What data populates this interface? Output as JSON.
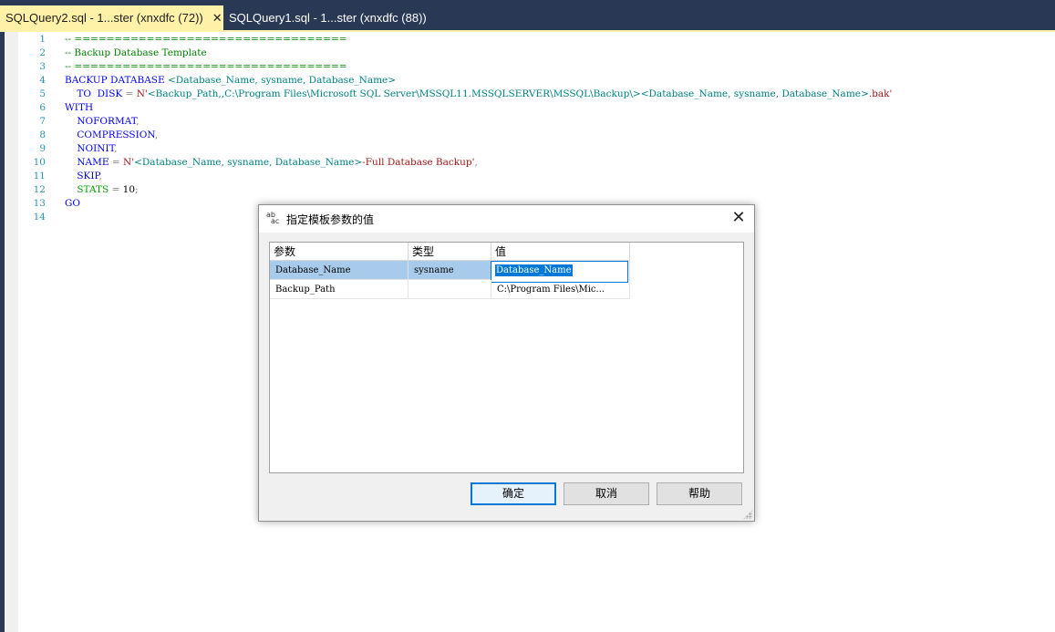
{
  "tabs": [
    {
      "label": "SQLQuery2.sql - 1...ster (xnxdfc (72))",
      "active": true,
      "close": "✕"
    },
    {
      "label": "SQLQuery1.sql - 1...ster (xnxdfc (88))",
      "active": false
    }
  ],
  "editor": {
    "line_numbers": [
      "1",
      "2",
      "3",
      "4",
      "5",
      "6",
      "7",
      "8",
      "9",
      "10",
      "11",
      "12",
      "13",
      "14"
    ],
    "lines": [
      [
        {
          "t": "-- ==================================",
          "c": "cm"
        }
      ],
      [
        {
          "t": "-- Backup Database Template",
          "c": "cm"
        }
      ],
      [
        {
          "t": "-- ==================================",
          "c": "cm"
        }
      ],
      [
        {
          "t": "BACKUP DATABASE ",
          "c": "kw"
        },
        {
          "t": "<Database_Name, sysname, Database_Name>",
          "c": "tl"
        }
      ],
      [
        {
          "t": "    TO  DISK ",
          "c": "kw"
        },
        {
          "t": "= ",
          "c": "gr"
        },
        {
          "t": "N'",
          "c": "str"
        },
        {
          "t": "<Backup_Path,,C:\\Program Files\\Microsoft SQL Server\\MSSQL11.MSSQLSERVER\\MSSQL\\Backup\\>",
          "c": "tl"
        },
        {
          "t": "<Database_Name, sysname, Database_Name>",
          "c": "tl"
        },
        {
          "t": ".bak'",
          "c": "str"
        }
      ],
      [
        {
          "t": "WITH",
          "c": "kw"
        }
      ],
      [
        {
          "t": "    NOFORMAT",
          "c": "kw"
        },
        {
          "t": ",",
          "c": "gr"
        }
      ],
      [
        {
          "t": "    COMPRESSION",
          "c": "kw"
        },
        {
          "t": ",",
          "c": "gr"
        }
      ],
      [
        {
          "t": "    NOINIT",
          "c": "kw"
        },
        {
          "t": ",",
          "c": "gr"
        }
      ],
      [
        {
          "t": "    NAME ",
          "c": "kw"
        },
        {
          "t": "= ",
          "c": "gr"
        },
        {
          "t": "N'",
          "c": "str"
        },
        {
          "t": "<Database_Name, sysname, Database_Name>",
          "c": "tl"
        },
        {
          "t": "-Full Database Backup'",
          "c": "str"
        },
        {
          "t": ",",
          "c": "gr"
        }
      ],
      [
        {
          "t": "    SKIP",
          "c": "kw"
        },
        {
          "t": ",",
          "c": "gr"
        }
      ],
      [
        {
          "t": "    STATS ",
          "c": "green2"
        },
        {
          "t": "= ",
          "c": "gr"
        },
        {
          "t": "10",
          "c": "bl"
        },
        {
          "t": ";",
          "c": "gr"
        }
      ],
      [
        {
          "t": "GO",
          "c": "kw"
        }
      ],
      []
    ]
  },
  "dialog": {
    "title": "指定模板参数的值",
    "icon_text": "ab\nac",
    "close": "✕",
    "columns": [
      "参数",
      "类型",
      "值"
    ],
    "rows": [
      {
        "param": "Database_Name",
        "type": "sysname",
        "value": "Database_Name",
        "selected": true
      },
      {
        "param": "Backup_Path",
        "type": "",
        "value": "C:\\Program Files\\Mic...",
        "selected": false
      }
    ],
    "buttons": {
      "ok": "确定",
      "cancel": "取消",
      "help": "帮助"
    }
  }
}
